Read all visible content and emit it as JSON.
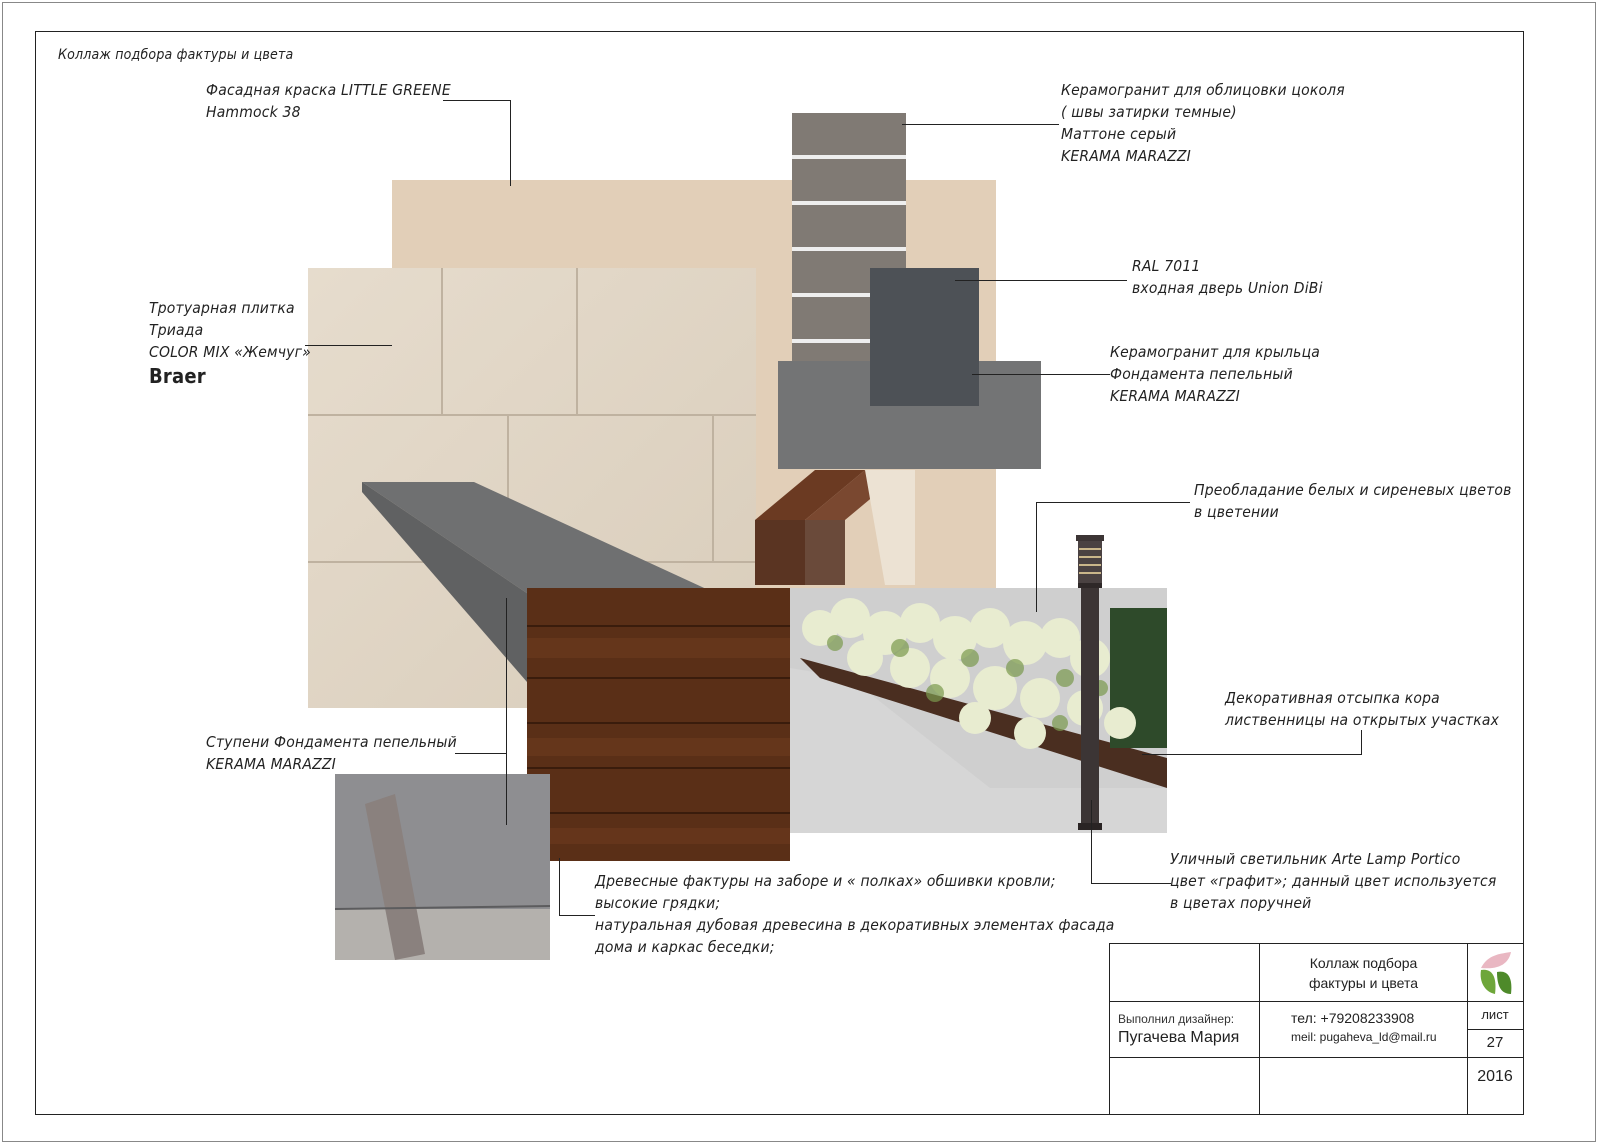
{
  "header": {
    "title": "Коллаж подбора фактуры и цвета"
  },
  "annotations": {
    "facade_paint": [
      "Фасадная краска LITTLE GREENE",
      "Hammock 38"
    ],
    "paving": [
      "Тротуарная плитка",
      "Триада",
      "COLOR MIX «Жемчуг»"
    ],
    "paving_brand": "Braer",
    "plinth_tile": [
      "Керамогранит для облицовки цоколя",
      "( швы затирки темные)",
      "Маттоне серый",
      "KERAMA MARAZZI"
    ],
    "door": [
      "RAL 7011",
      "входная дверь Union DiBi"
    ],
    "porch_tile": [
      "Керамогранит для крыльца",
      "Фондамента пепельный",
      "KERAMA MARAZZI"
    ],
    "flowers": [
      "Преобладание белых и сиреневых цветов",
      "в цветении"
    ],
    "bark": [
      "Декоративная отсыпка кора",
      "лиственницы на открытых участках"
    ],
    "steps": [
      "Ступени  Фондамента пепельный",
      "KERAMA MARAZZI"
    ],
    "lamp": [
      "Уличный светильник Arte Lamp Portico",
      "цвет «графит»; данный цвет используется",
      "в цветах поручней"
    ],
    "wood": [
      "Древесные фактуры на заборе и « полках» обшивки кровли;",
      "высокие грядки;",
      "натуральная дубовая древесина в декоративных элементах фасада",
      "дома и каркас беседки;"
    ]
  },
  "title_block": {
    "sheet_title": [
      "Коллаж подбора",
      "фактуры и цвета"
    ],
    "designer_caption": "Выполнил дизайнер:",
    "designer_name": "Пугачева Мария",
    "phone": "тел: +79208233908",
    "email": "meil: pugaheva_ld@mail.ru",
    "sheet_label": "лист",
    "sheet_number": "27",
    "year": "2016"
  },
  "colors": {
    "facade": "#e2cfb8",
    "paving": "#e4dacb",
    "plinth": "#7d7872",
    "door": "#4d5156",
    "porch": "#727374",
    "wood": "#5a2f17",
    "step": "#6e6f70",
    "lamp": "#3c3535",
    "lines": "#222222"
  }
}
